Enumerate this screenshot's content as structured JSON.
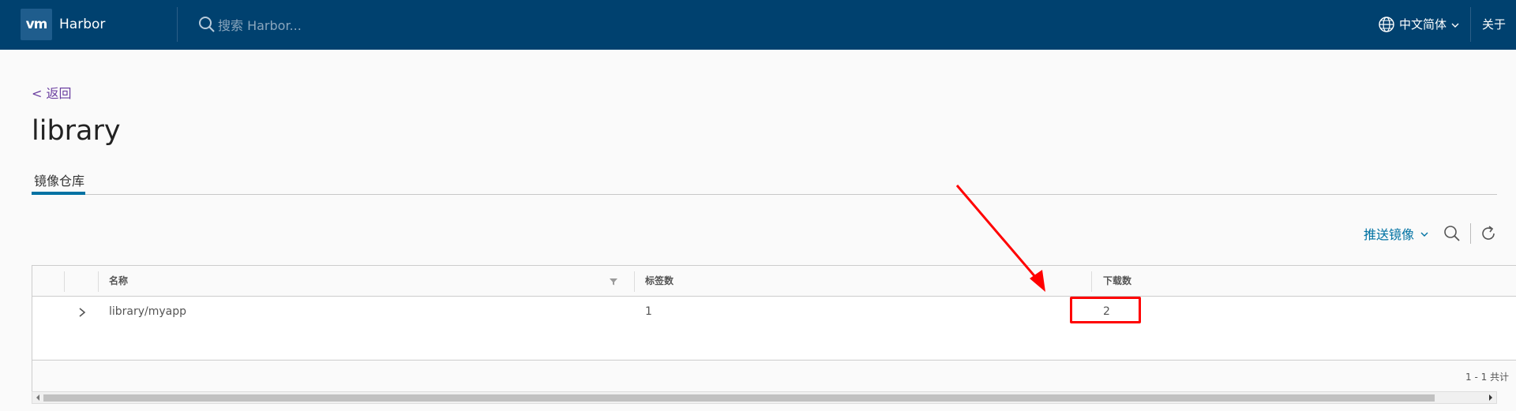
{
  "header": {
    "logo_text": "vm",
    "app_name": "Harbor",
    "search_placeholder": "搜索 Harbor...",
    "language": "中文简体",
    "about": "关于"
  },
  "nav": {
    "back_label": "< 返回"
  },
  "page": {
    "title": "library"
  },
  "tabs": [
    {
      "label": "镜像仓库",
      "active": true
    }
  ],
  "toolbar": {
    "push_label": "推送镜像"
  },
  "table": {
    "columns": [
      "名称",
      "标签数",
      "下载数"
    ],
    "rows": [
      {
        "name": "library/myapp",
        "tags": "1",
        "downloads": "2"
      }
    ],
    "pagination": "1 - 1 共计"
  },
  "annotation": {
    "color": "#ff0000"
  },
  "colors": {
    "header_bg": "#00416f",
    "accent": "#0072a3",
    "link": "#6b3fa0"
  }
}
